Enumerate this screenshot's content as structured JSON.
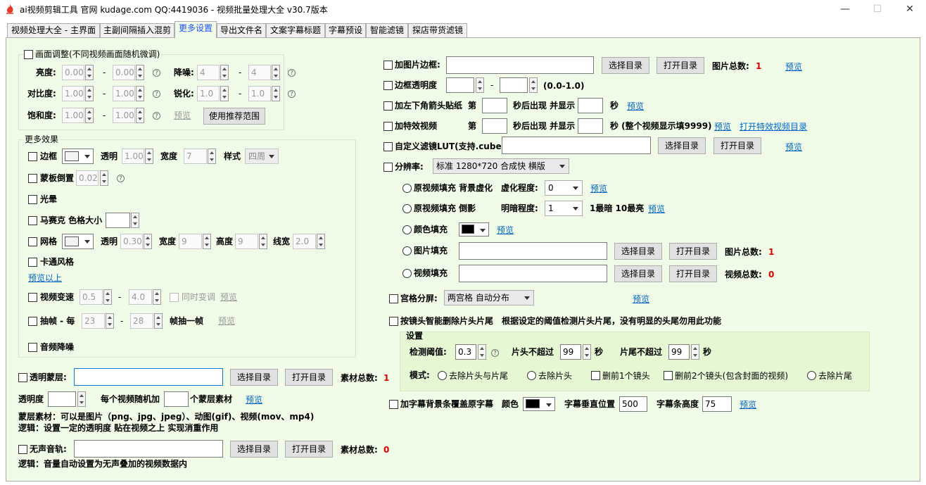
{
  "window": {
    "title": "ai视频剪辑工具 官网 kudage.com QQ:4419036 -  视频批量处理大全  v30.7版本",
    "minimize": "—",
    "maximize": "☐",
    "close": "✕"
  },
  "tabs": [
    "视频处理大全 - 主界面",
    "主副间隔插入混剪",
    "更多设置",
    "导出文件名",
    "文案字幕标题",
    "字幕预设",
    "智能滤镜",
    "探店带货滤镜"
  ],
  "icons": {
    "app": "flame-app-icon",
    "help": "help-circle-icon"
  },
  "common": {
    "dash": "-",
    "help": "?",
    "select_dir": "选择目录",
    "open_dir": "打开目录",
    "preview": "预览"
  },
  "adjust": {
    "title": "画面调整(不同视频画面随机微调)",
    "brightness": {
      "label": "亮度:",
      "min": "0.00",
      "max": "0.00"
    },
    "contrast": {
      "label": "对比度:",
      "min": "1.00",
      "max": "1.00"
    },
    "saturation": {
      "label": "饱和度:",
      "min": "1.00",
      "max": "1.00"
    },
    "denoise": {
      "label": "降噪:",
      "min": "4",
      "max": "4"
    },
    "sharpen": {
      "label": "锐化:",
      "min": "1.0",
      "max": "1.0"
    },
    "preview": "预览",
    "recommend_button": "使用推荐范围"
  },
  "effects": {
    "title": "更多效果",
    "border": {
      "label": "边框",
      "opacity_label": "透明",
      "opacity": "1.00",
      "width_label": "宽度",
      "width": "7",
      "style_label": "样式",
      "style": "四周"
    },
    "mask_flip": {
      "label": "蒙板倒置",
      "value": "0.02"
    },
    "halo": "光晕",
    "mosaic": {
      "label": "马赛克 色格大小",
      "value": ""
    },
    "grid": {
      "label": "网格",
      "opacity_label": "透明",
      "opacity": "0.30",
      "width_label": "宽度",
      "width": "9",
      "height_label": "高度",
      "height": "9",
      "line_label": "线宽",
      "line": "2.0"
    },
    "cartoon": "卡通风格",
    "preview_above": "预览以上",
    "speed": {
      "label": "视频变速",
      "min": "0.5",
      "max": "4.0",
      "pitch_label": "同时变调",
      "preview": "预览"
    },
    "frame_drop": {
      "label": "抽帧 - 每",
      "min": "23",
      "max": "28",
      "suffix": "帧抽一帧",
      "preview": "预览"
    },
    "audio_denoise": "音频降噪"
  },
  "overlay": {
    "label": "透明蒙层:",
    "value": "",
    "total_label": "素材总数:",
    "total": "1",
    "opacity_label": "透明度",
    "opacity": "",
    "per_video_label": "每个视频随机加",
    "per_video": "",
    "per_video_suffix": "个蒙层素材",
    "preview": "预览",
    "note1": "蒙层素材：可以是图片（png、jpg、jpeg）、动图(gif)、视频(mov、mp4)",
    "note2": "逻辑：设置一定的透明度 贴在视频之上 实现消重作用"
  },
  "mute": {
    "label": "无声音轨:",
    "value": "",
    "total_label": "素材总数:",
    "total": "0",
    "note": "逻辑：音量自动设置为无声叠加的视频数据内"
  },
  "right": {
    "frame": {
      "label": "加图片边框:",
      "value": "",
      "total_label": "图片总数:",
      "total": "1",
      "preview": "预览"
    },
    "frame_opacity": {
      "label": "边框透明度",
      "min": "",
      "max": "",
      "range": "(0.0-1.0)"
    },
    "arrow": {
      "label": "加左下角箭头贴纸",
      "nth": "第",
      "appear": "秒后出现 并显示",
      "sec": "秒",
      "preview": "预览"
    },
    "fx": {
      "label": "加特效视频",
      "nth": "第",
      "appear": "秒后出现 并显示",
      "sec": "秒 (整个视频显示填9999)",
      "preview": "预览",
      "open_link": "打开特效视频目录"
    },
    "lut": {
      "label": "自定义滤镜LUT(支持.cube)",
      "value": "",
      "preview": "预览"
    },
    "resolution": {
      "label": "分辨率:",
      "value": "标准 1280*720 合成快 横版"
    },
    "fill_blur": {
      "label": "原视频填充 背景虚化",
      "deg_label": "虚化程度:",
      "deg": "0",
      "preview": "预览"
    },
    "fill_invert": {
      "label": "原视频填充 倒影",
      "dark_label": "明暗程度:",
      "dark": "1",
      "hint": "1最暗 10最亮",
      "preview": "预览"
    },
    "fill_color": {
      "label": "颜色填充",
      "preview": "预览"
    },
    "fill_image": {
      "label": "图片填充",
      "value": "",
      "total_label": "图片总数:",
      "total": "1"
    },
    "fill_video": {
      "label": "视频填充",
      "value": "",
      "total_label": "视频总数:",
      "total": "0"
    },
    "split": {
      "label": "宫格分屏:",
      "value": "两宫格 自动分布",
      "preview": "预览"
    },
    "scene": {
      "label": "按镜头智能删除片头片尾",
      "desc": "根据设定的阈值检测片头片尾，没有明显的头尾勿用此功能"
    },
    "settings": {
      "title": "设置",
      "thresh_label": "检测阈值:",
      "thresh": "0.3",
      "head_label": "片头不超过",
      "head": "99",
      "head_sec": "秒",
      "tail_label": "片尾不超过",
      "tail": "99",
      "tail_sec": "秒",
      "mode_label": "模式:",
      "modes": [
        "去除片头与片尾",
        "去除片头",
        "删前1个镜头",
        "删前2个镜头(包含封面的视频)",
        "去除片尾"
      ]
    },
    "subbar": {
      "label": "加字幕背景条覆盖原字幕",
      "color_label": "颜色",
      "pos_label": "字幕垂直位置",
      "pos": "500",
      "h_label": "字幕条高度",
      "h": "75",
      "preview": "预览"
    }
  },
  "colors": {
    "panel_bg": "#f0fbe8",
    "active_tab": "#1e50ff",
    "link": "#0066cc",
    "count": "#e00000",
    "swatch_black": "#000000",
    "swatch_white": "#f4f4f4"
  }
}
